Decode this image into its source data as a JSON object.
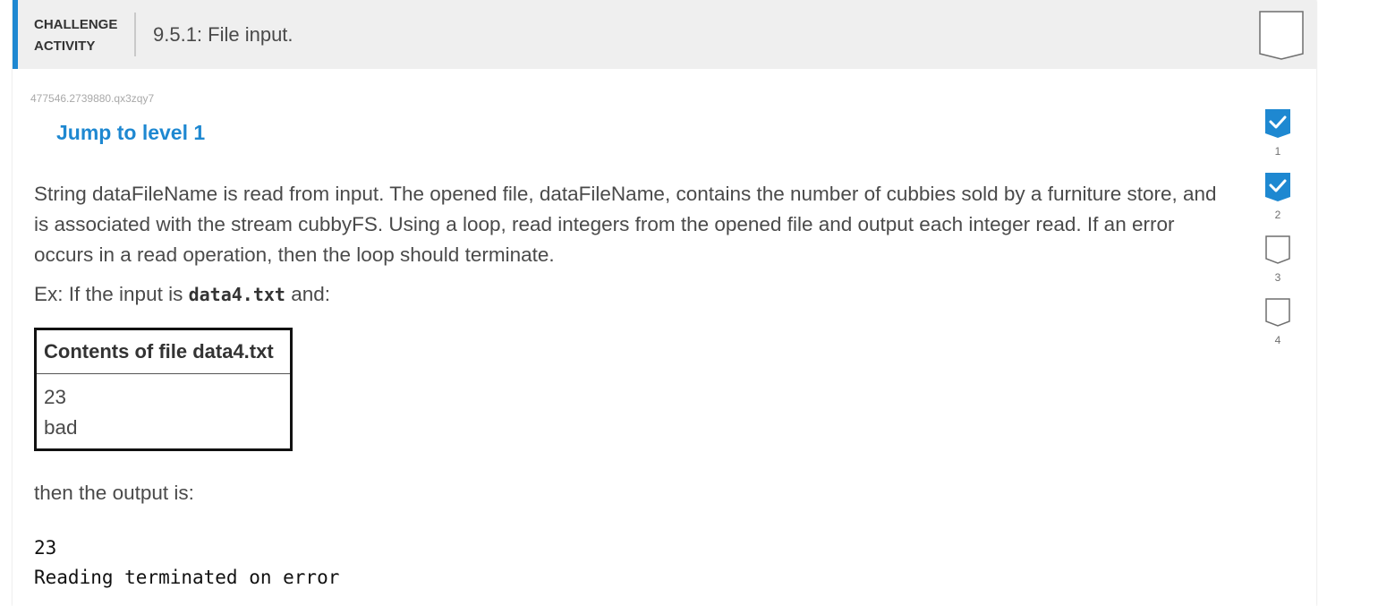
{
  "header": {
    "activity_type_line1": "CHALLENGE",
    "activity_type_line2": "ACTIVITY",
    "title": "9.5.1: File input.",
    "accent_color": "#1e88d1"
  },
  "activity_id": "477546.2739880.qx3zqy7",
  "jump_link": "Jump to level 1",
  "prompt": "String dataFileName is read from input. The opened file, dataFileName, contains the number of cubbies sold by a furniture store, and is associated with the stream cubbyFS. Using a loop, read integers from the opened file and output each integer read. If an error occurs in a read operation, then the loop should terminate.",
  "example": {
    "prefix": "Ex: If the input is ",
    "filename": "data4.txt",
    "suffix": " and:"
  },
  "file_table": {
    "header": "Contents of file data4.txt",
    "lines": [
      "23",
      "bad"
    ]
  },
  "then_text": "then the output is:",
  "output": {
    "lines": [
      "23",
      "Reading terminated on error"
    ]
  },
  "levels": [
    {
      "number": "1",
      "completed": true
    },
    {
      "number": "2",
      "completed": true
    },
    {
      "number": "3",
      "completed": false
    },
    {
      "number": "4",
      "completed": false
    }
  ],
  "icons": {
    "completion_badge": "bookmark-badge-icon",
    "level_completed": "check-shield-icon",
    "level_incomplete": "empty-shield-icon"
  }
}
